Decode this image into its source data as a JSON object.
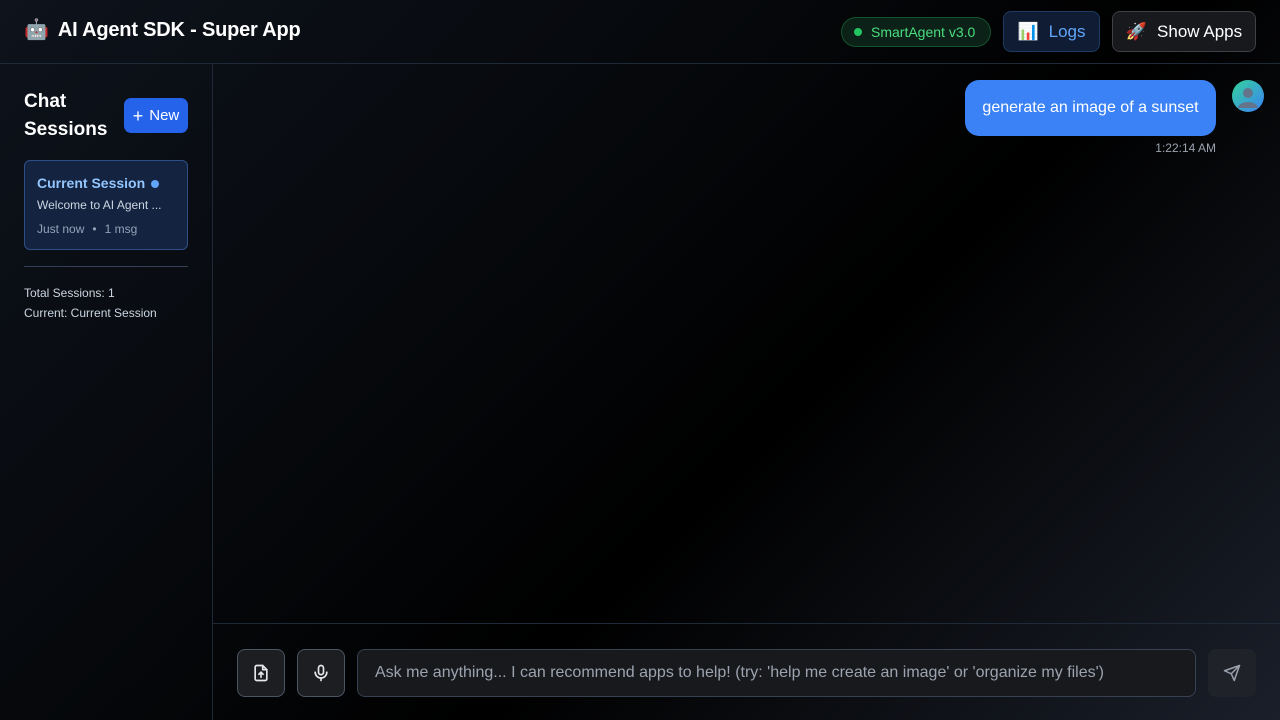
{
  "header": {
    "robot_emoji": "🤖",
    "title": "AI Agent SDK - Super App",
    "status_badge": "SmartAgent v3.0",
    "logs_emoji": "📊",
    "logs_label": "Logs",
    "apps_emoji": "🚀",
    "apps_label": "Show Apps"
  },
  "sidebar": {
    "title": "Chat Sessions",
    "new_label": "New",
    "sessions": [
      {
        "name": "Current Session",
        "preview": "Welcome to AI Agent ...",
        "time": "Just now",
        "separator": "•",
        "count": "1 msg"
      }
    ],
    "stats": {
      "total": "Total Sessions: 1",
      "current": "Current: Current Session"
    }
  },
  "chat": {
    "messages": [
      {
        "role": "user",
        "text": "generate an image of a sunset",
        "time": "1:22:14 AM"
      }
    ]
  },
  "composer": {
    "placeholder": "Ask me anything... I can recommend apps to help! (try: 'help me create an image' or 'organize my files')"
  },
  "colors": {
    "accent": "#2563eb",
    "user_bubble": "#3b82f6",
    "status_green": "#22c55e"
  }
}
